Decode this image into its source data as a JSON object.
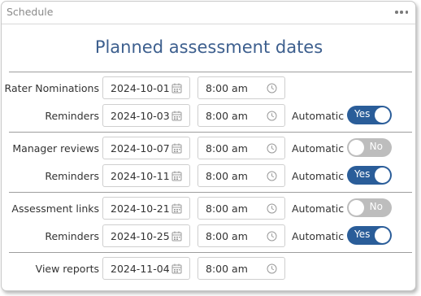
{
  "panel": {
    "title": "Schedule",
    "menu_icon": "more-horizontal-icon"
  },
  "heading": "Planned assessment dates",
  "automatic_label": "Automatic",
  "rows": [
    {
      "label": "Rater Nominations",
      "date": "2024-10-01",
      "time": "8:00 am",
      "automatic": null
    },
    {
      "label": "Reminders",
      "date": "2024-10-03",
      "time": "8:00 am",
      "automatic": "Yes"
    },
    {
      "label": "Manager reviews",
      "date": "2024-10-07",
      "time": "8:00 am",
      "automatic": "No"
    },
    {
      "label": "Reminders",
      "date": "2024-10-11",
      "time": "8:00 am",
      "automatic": "Yes"
    },
    {
      "label": "Assessment links",
      "date": "2024-10-21",
      "time": "8:00 am",
      "automatic": "No"
    },
    {
      "label": "Reminders",
      "date": "2024-10-25",
      "time": "8:00 am",
      "automatic": "Yes"
    },
    {
      "label": "View reports",
      "date": "2024-11-04",
      "time": "8:00 am",
      "automatic": null
    }
  ],
  "colors": {
    "heading": "#3d5f8e",
    "toggle_on": "#2a5d99",
    "toggle_off": "#bdbdbd"
  }
}
